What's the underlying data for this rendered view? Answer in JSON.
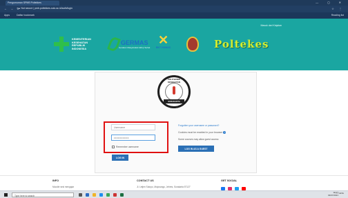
{
  "browser": {
    "tab_title": "Pengumuman SPMB Poltekkes",
    "window_controls": "— ◻ ✕",
    "nav_buttons": "← → ↻",
    "address": "▲ Not secure | pmb.poltekkes-solo.ac.id/auth/login",
    "extensions": "☆ ⋮",
    "bookmarks": [
      "Apps",
      "Daftar bookmark"
    ],
    "bookmarks_right": "Reading list"
  },
  "header": {
    "top_info": "Masuk dari Kiajalan",
    "kemenkes_lines": [
      "KEMENTERIAN",
      "KESEHATAN",
      "REPUBLIK",
      "INDONESIA"
    ],
    "germas_title": "GERMAS",
    "germas_sub": "Gerakan Masyarakat Hidup Sehat",
    "bkt_label": "BKT HUMAS",
    "poltekkes": "Poltekes"
  },
  "seal": {
    "arc_text": "POLITEKNIK KESEHATAN",
    "ribbon": "SURAKARTA"
  },
  "form": {
    "username_placeholder": "Username",
    "password_value": "••••••••••••",
    "remember_label": "Remember username",
    "login_label": "LOG IN",
    "forgot_text": "Forgotten your username or password?",
    "cookies_text": "Cookies must be enabled in your browser",
    "help_text": "Some courses may allow guest access",
    "register_label": "LOG IN AS A GUEST"
  },
  "footer": {
    "info_title": "INFO",
    "info_sub": "Moodle sesi mengajar",
    "contact_title": "CONTACT US",
    "contact_sub": "Jl. Letjen Sutoyo, Mojosongo, Jebres, Surakarta 57127",
    "social_title": "GET SOCIAL",
    "social_colors": [
      "#1877f2",
      "#e1306c",
      "#1da1f2",
      "#ff0000"
    ]
  },
  "taskbar": {
    "search_placeholder": "Type here to search",
    "time": "10:27",
    "date": "03/07/2021",
    "tray": "^ ⌂ ♪ ENG"
  },
  "colors": {
    "header_teal": "#1aa6a1",
    "button_blue": "#2a6fb5",
    "highlight_red": "#e01010"
  }
}
